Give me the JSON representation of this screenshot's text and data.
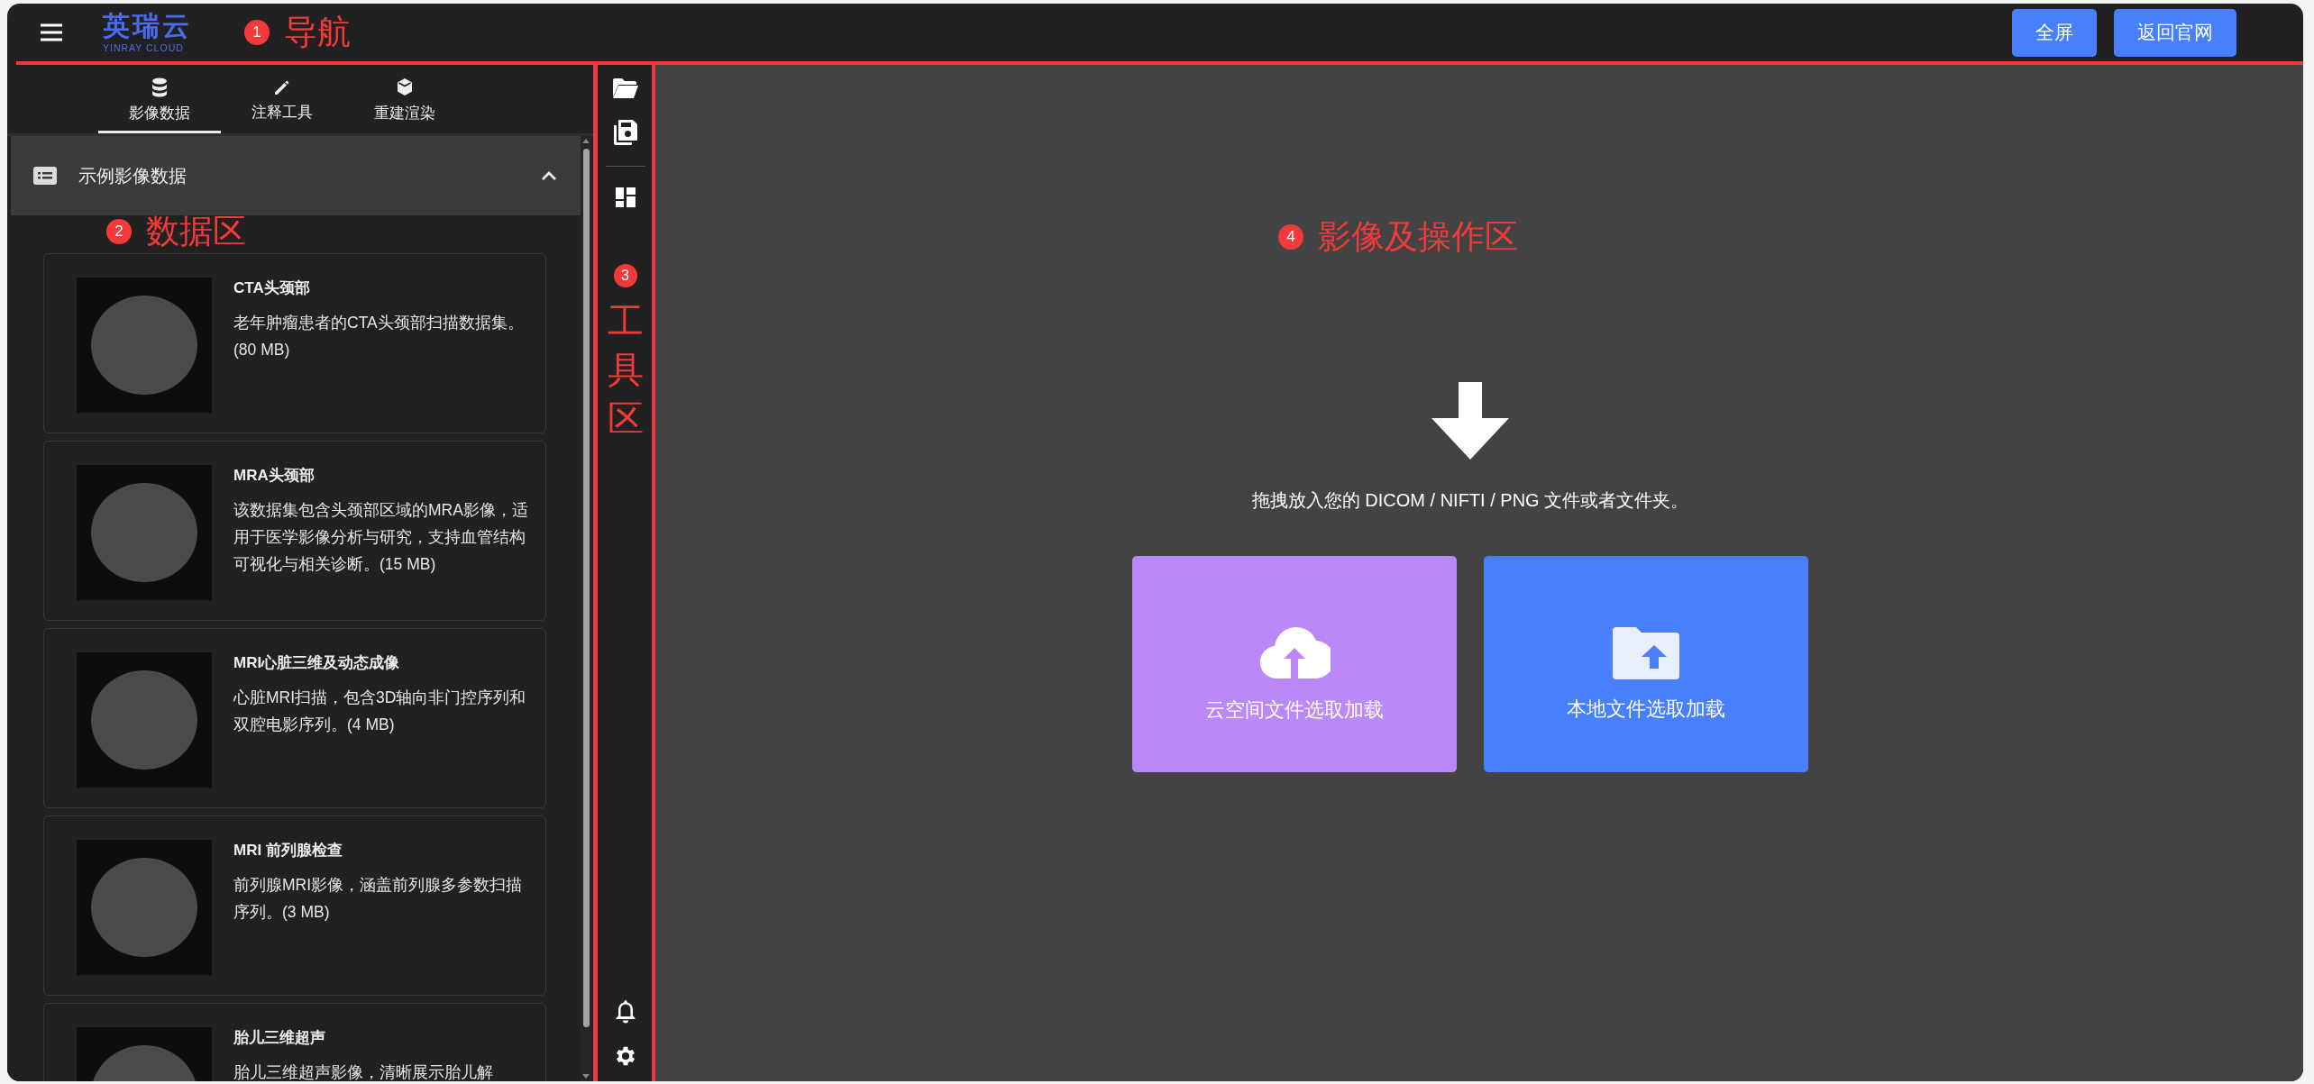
{
  "header": {
    "logo": {
      "name": "英瑞云",
      "tagline": "YINRAY CLOUD"
    },
    "buttons": [
      "全屏",
      "返回官网"
    ]
  },
  "annotations": [
    {
      "number": "1",
      "label": "导航"
    },
    {
      "number": "2",
      "label": "数据区"
    },
    {
      "number": "3",
      "label": "工具区"
    },
    {
      "number": "4",
      "label": "影像及操作区"
    }
  ],
  "sidebar": {
    "tabs": [
      {
        "label": "影像数据",
        "selected": true
      },
      {
        "label": "注释工具",
        "selected": false
      },
      {
        "label": "重建渲染",
        "selected": false
      }
    ],
    "section": {
      "title": "示例影像数据",
      "expanded": true
    },
    "datasets": [
      {
        "title": "CTA头颈部",
        "description": "老年肿瘤患者的CTA头颈部扫描数据集。(80 MB)"
      },
      {
        "title": "MRA头颈部",
        "description": "该数据集包含头颈部区域的MRA影像，适用于医学影像分析与研究，支持血管结构可视化与相关诊断。(15 MB)"
      },
      {
        "title": "MRI心脏三维及动态成像",
        "description": "心脏MRI扫描，包含3D轴向非门控序列和双腔电影序列。(4 MB)"
      },
      {
        "title": "MRI 前列腺检查",
        "description": "前列腺MRI影像，涵盖前列腺多参数扫描序列。(3 MB)"
      },
      {
        "title": "胎儿三维超声",
        "description": "胎儿三维超声影像，清晰展示胎儿解"
      }
    ]
  },
  "dropzone": {
    "hint": "拖拽放入您的 DICOM / NIFTI / PNG 文件或者文件夹。",
    "buttons": [
      {
        "label": "云空间文件选取加载",
        "kind": "cloud",
        "color": "#bb88fa"
      },
      {
        "label": "本地文件选取加载",
        "kind": "local",
        "color": "#4880fc"
      }
    ]
  }
}
